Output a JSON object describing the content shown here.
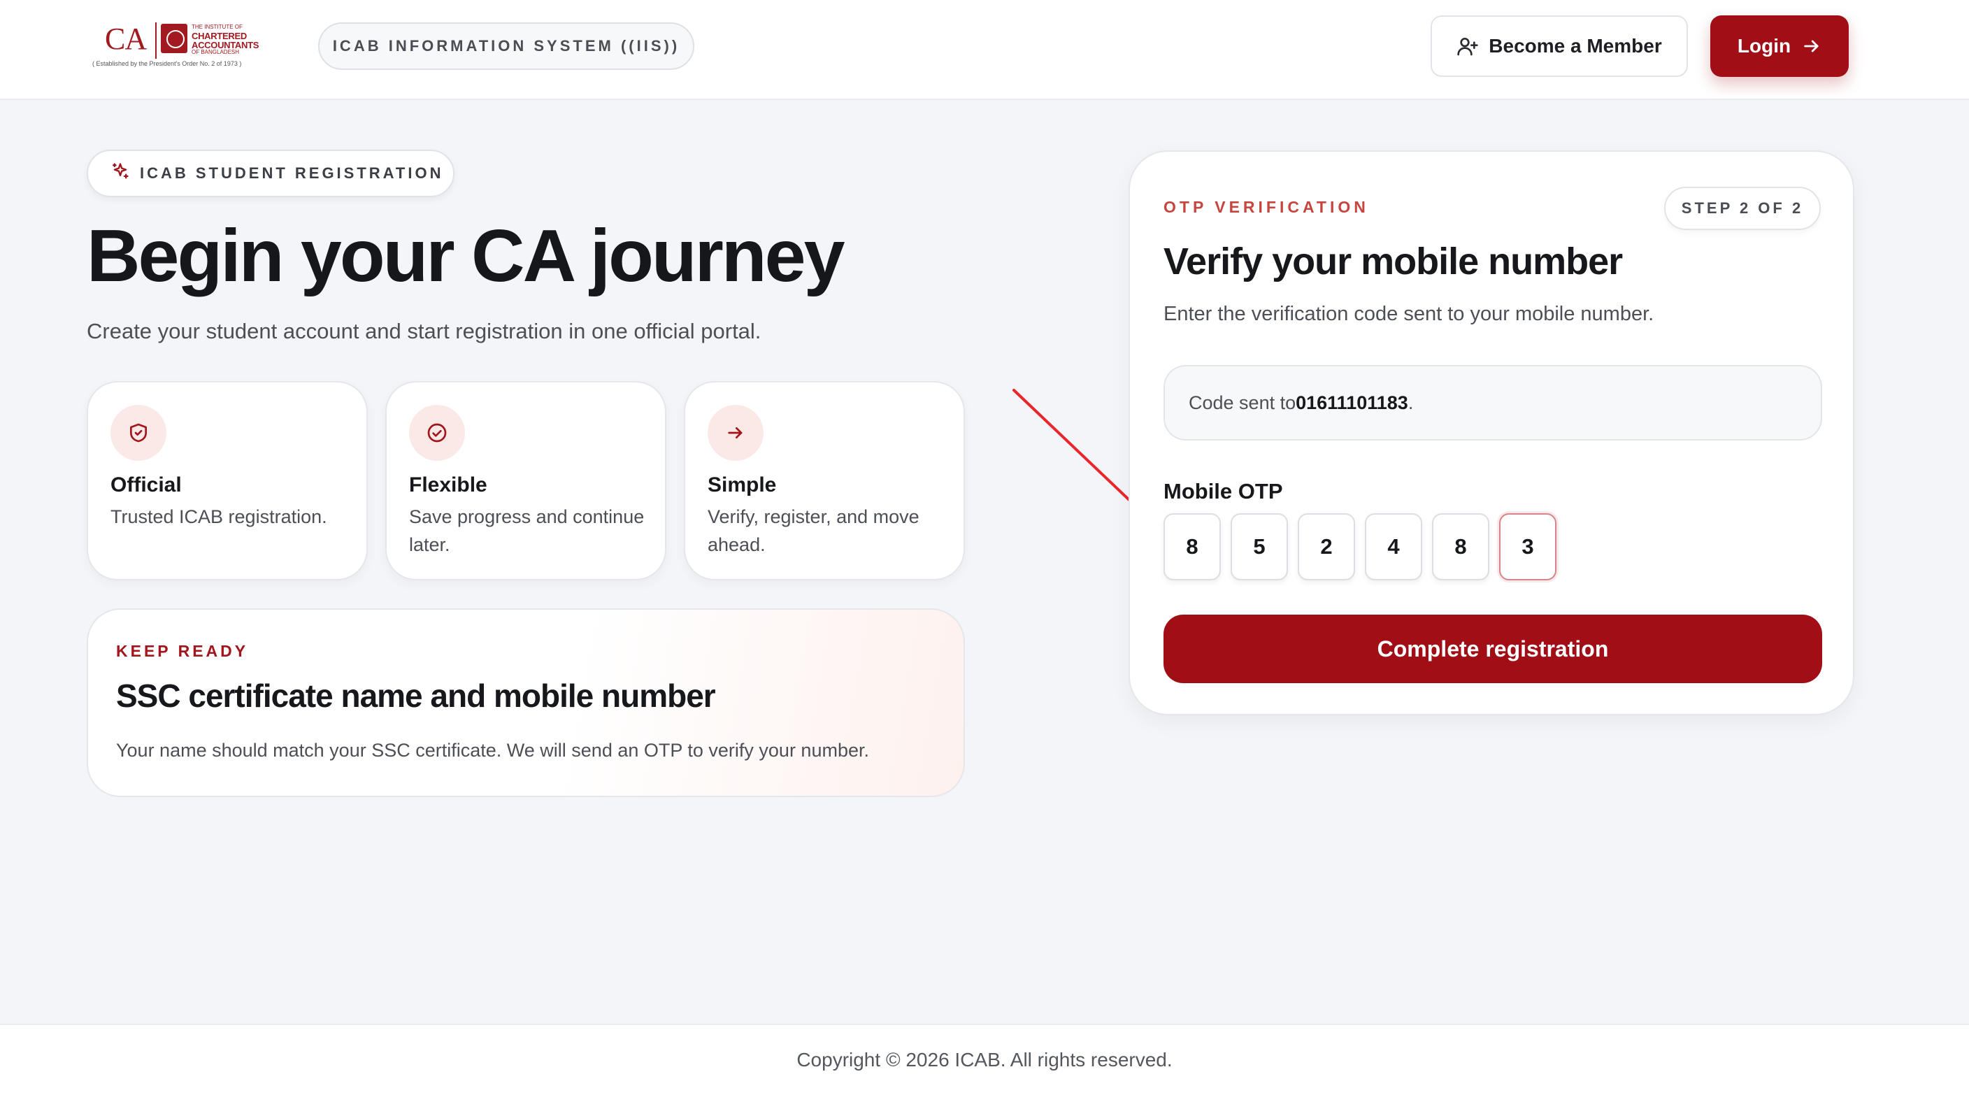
{
  "header": {
    "logo": {
      "mark": "CA",
      "line1": "THE INSTITUTE OF",
      "line2": "CHARTERED",
      "line3": "ACCOUNTANTS",
      "line4": "OF BANGLADESH",
      "tagline": "( Established by the President's Order No. 2 of 1973 )"
    },
    "system_name": "ICAB INFORMATION SYSTEM ((IIS))",
    "become_member_label": "Become a Member",
    "login_label": "Login"
  },
  "hero": {
    "badge": "ICAB STUDENT REGISTRATION",
    "title": "Begin your CA journey",
    "subtitle": "Create your student account and start registration in one official portal.",
    "features": [
      {
        "icon": "shield-icon",
        "title": "Official",
        "desc": "Trusted ICAB registration."
      },
      {
        "icon": "check-circle-icon",
        "title": "Flexible",
        "desc": "Save progress and continue later."
      },
      {
        "icon": "arrow-right-icon",
        "title": "Simple",
        "desc": "Verify, register, and move ahead."
      }
    ],
    "ready": {
      "kicker": "KEEP READY",
      "title": "SSC certificate name and mobile number",
      "desc": "Your name should match your SSC certificate. We will send an OTP to verify your number."
    }
  },
  "otp": {
    "kicker": "OTP VERIFICATION",
    "step": "STEP 2 OF 2",
    "title": "Verify your mobile number",
    "subtitle": "Enter the verification code sent to your mobile number.",
    "sent_prefix": "Code sent to ",
    "phone": "01611101183",
    "sent_suffix": ".",
    "label": "Mobile OTP",
    "digits": [
      "8",
      "5",
      "2",
      "4",
      "8",
      "3"
    ],
    "submit_label": "Complete registration"
  },
  "footer": {
    "copyright": "Copyright © 2026 ICAB. All rights reserved."
  },
  "colors": {
    "brand": "#a10e16",
    "accent_soft": "#fbe9e8",
    "annotation": "#e8262b"
  }
}
